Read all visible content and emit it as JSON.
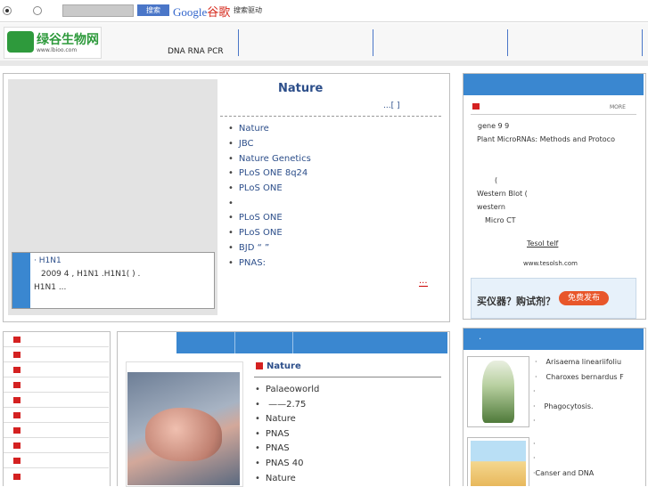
{
  "topbar": {
    "radio_options": [
      {
        "selected": true
      },
      {
        "selected": false
      }
    ],
    "search_placeholder": "",
    "search_button": "搜索",
    "google_logo": [
      "Google",
      "谷歌"
    ],
    "google_tag": "搜索驱动"
  },
  "header": {
    "logo_text": "绿谷生物网",
    "logo_url": "www.lbioo.com",
    "nav_items": [
      "DNA RNA PCR",
      "",
      "",
      "",
      ""
    ]
  },
  "news": {
    "title": "Nature",
    "more_link": "...[   ]",
    "caption_line1": "· H1N1",
    "caption_line2": "2009 4 ,          H1N1   .H1N1(  )      .",
    "caption_line3": "H1N1    ...",
    "items": [
      "Nature",
      "JBC",
      "Nature Genetics",
      "PLoS ONE     8q24",
      "PLoS ONE",
      "",
      "PLoS ONE",
      "PLoS ONE",
      "BJD       “  ”",
      "PNAS:"
    ],
    "more": "..."
  },
  "right_panel": {
    "header": "",
    "more_label": "MORE",
    "lines": [
      "gene 9     9",
      "Plant MicroRNAs: Methods and Protoco",
      "",
      "",
      "(",
      "Western Blot (",
      "western",
      "Micro CT"
    ],
    "tesol_link": "Tesol     telf",
    "tesol_url": "www.tesolsh.com",
    "ad_question": "买仪器？购试剂？",
    "ad_button": "免费发布"
  },
  "left_list": {
    "count": 10
  },
  "mid_section": {
    "tabs": [
      "",
      "",
      "",
      ""
    ],
    "heading": "Nature",
    "items": [
      "Palaeoworld",
      "          ——2.75",
      "Nature",
      "PNAS",
      "PNAS",
      "PNAS          40",
      "Nature"
    ]
  },
  "bottom_right": {
    "header": "",
    "items": [
      "Arisaema lineariifoliu",
      "Charoxes bernardus F",
      "",
      "Phagocytosis.",
      "",
      "",
      "Canser and DNA"
    ]
  },
  "colors": {
    "accent": "#3a87d0",
    "link": "#2c4e8a",
    "red": "#d42121",
    "brand_green": "#2e9a3c"
  }
}
